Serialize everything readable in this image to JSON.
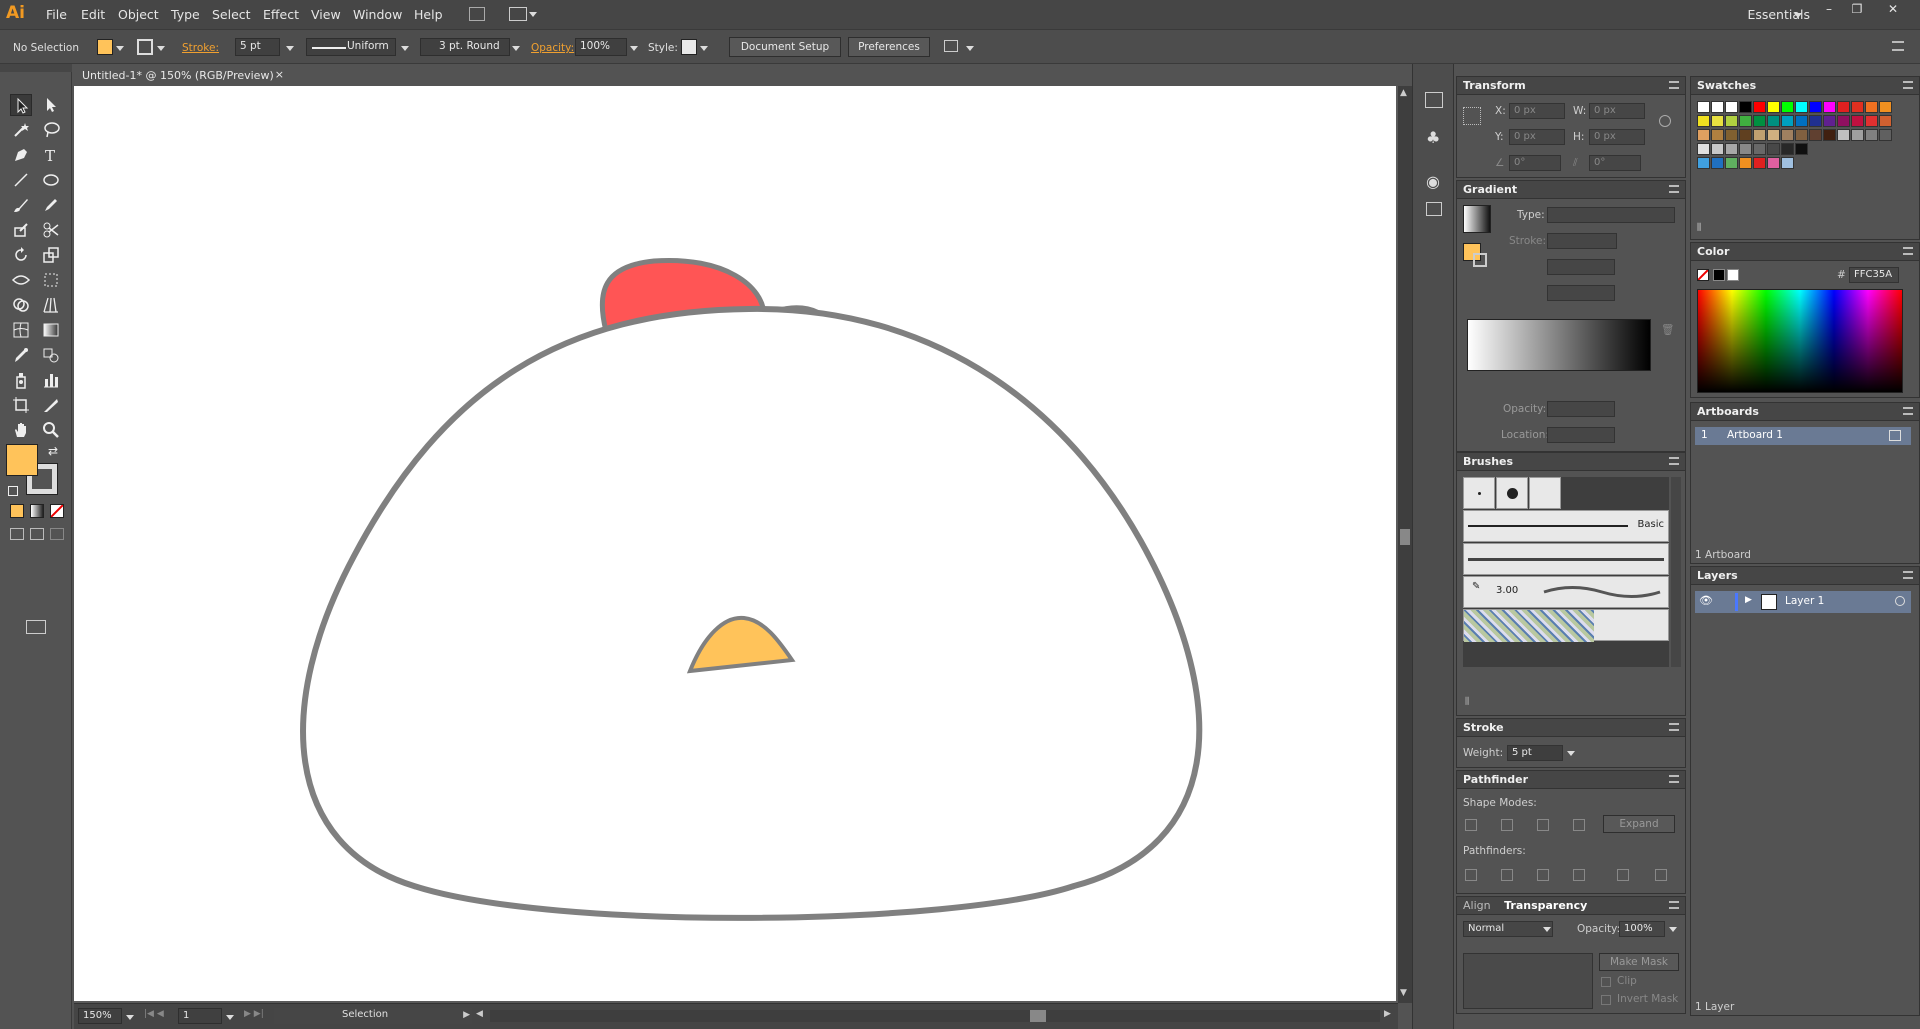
{
  "app": {
    "logo": "Ai",
    "workspace": "Essentials"
  },
  "menu": [
    "File",
    "Edit",
    "Object",
    "Type",
    "Select",
    "Effect",
    "View",
    "Window",
    "Help"
  ],
  "control_bar": {
    "selection": "No Selection",
    "stroke_label": "Stroke:",
    "stroke_value": "5 pt",
    "profile": "Uniform",
    "brush": "3 pt. Round",
    "opacity_label": "Opacity:",
    "opacity_value": "100%",
    "style_label": "Style:",
    "document_setup": "Document Setup",
    "preferences": "Preferences"
  },
  "document": {
    "tab_title": "Untitled-1* @ 150% (RGB/Preview)",
    "close": "×"
  },
  "status": {
    "zoom": "150%",
    "page": "1",
    "tool": "Selection"
  },
  "transform": {
    "title": "Transform",
    "x_label": "X:",
    "x": "0 px",
    "y_label": "Y:",
    "y": "0 px",
    "w_label": "W:",
    "w": "0 px",
    "h_label": "H:",
    "h": "0 px",
    "angle": "0°",
    "shear": "0°"
  },
  "gradient": {
    "title": "Gradient",
    "type_label": "Type:",
    "stroke_label": "Stroke:",
    "opacity_label": "Opacity:",
    "location_label": "Location:"
  },
  "brushes": {
    "title": "Brushes",
    "basic": "Basic",
    "size": "3.00"
  },
  "stroke_panel": {
    "title": "Stroke",
    "weight_label": "Weight:",
    "weight": "5 pt"
  },
  "pathfinder": {
    "title": "Pathfinder",
    "shape_modes": "Shape Modes:",
    "pathfinders": "Pathfinders:",
    "expand": "Expand"
  },
  "transparency": {
    "tab_align": "Align",
    "tab_transparency": "Transparency",
    "mode": "Normal",
    "opacity_label": "Opacity:",
    "opacity": "100%",
    "make_mask": "Make Mask",
    "clip": "Clip",
    "invert_mask": "Invert Mask"
  },
  "swatches": {
    "title": "Swatches"
  },
  "color": {
    "title": "Color",
    "hex_label": "#",
    "hex": "FFC35A"
  },
  "artboards": {
    "title": "Artboards",
    "rows": [
      {
        "num": "1",
        "name": "Artboard 1"
      }
    ],
    "footer": "1 Artboard"
  },
  "layers": {
    "title": "Layers",
    "rows": [
      {
        "name": "Layer 1"
      }
    ],
    "footer": "1 Layer"
  },
  "colors": {
    "fill": "#FFC35A",
    "comb": "#FF5555",
    "beak": "#FFC35A",
    "body_stroke": "#808080"
  }
}
